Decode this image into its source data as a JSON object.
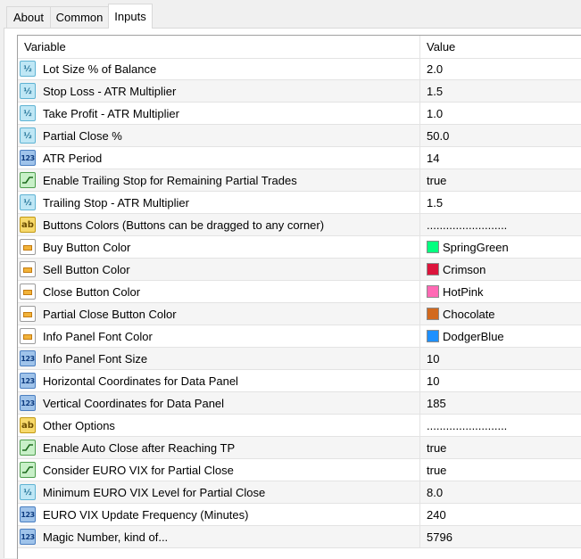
{
  "tabs": [
    {
      "label": "About"
    },
    {
      "label": "Common"
    },
    {
      "label": "Inputs"
    }
  ],
  "grid": {
    "headers": {
      "variable": "Variable",
      "value": "Value"
    },
    "rows": [
      {
        "icon": "fraction-icon",
        "name": "Lot Size % of Balance",
        "value": "2.0"
      },
      {
        "icon": "fraction-icon",
        "name": "Stop Loss - ATR Multiplier",
        "value": "1.5"
      },
      {
        "icon": "fraction-icon",
        "name": "Take Profit - ATR Multiplier",
        "value": "1.0"
      },
      {
        "icon": "fraction-icon",
        "name": "Partial Close %",
        "value": "50.0"
      },
      {
        "icon": "integer-icon",
        "name": "ATR Period",
        "value": "14"
      },
      {
        "icon": "boolean-icon",
        "name": "Enable Trailing Stop for Remaining Partial Trades",
        "value": "true"
      },
      {
        "icon": "fraction-icon",
        "name": "Trailing Stop - ATR Multiplier",
        "value": "1.5"
      },
      {
        "icon": "string-icon",
        "name": "Buttons Colors (Buttons can be dragged to any corner)",
        "value": "........................."
      },
      {
        "icon": "color-icon",
        "name": "Buy Button Color",
        "value": "SpringGreen",
        "swatch": "#00ff7f"
      },
      {
        "icon": "color-icon",
        "name": "Sell Button Color",
        "value": "Crimson",
        "swatch": "#dc143c"
      },
      {
        "icon": "color-icon",
        "name": "Close Button Color",
        "value": "HotPink",
        "swatch": "#ff69b4"
      },
      {
        "icon": "color-icon",
        "name": "Partial Close Button Color",
        "value": "Chocolate",
        "swatch": "#d2691e"
      },
      {
        "icon": "color-icon",
        "name": "Info Panel Font Color",
        "value": "DodgerBlue",
        "swatch": "#1e90ff"
      },
      {
        "icon": "integer-icon",
        "name": "Info Panel Font Size",
        "value": "10"
      },
      {
        "icon": "integer-icon",
        "name": "Horizontal Coordinates for Data Panel",
        "value": "10"
      },
      {
        "icon": "integer-icon",
        "name": "Vertical Coordinates for Data Panel",
        "value": "185"
      },
      {
        "icon": "string-icon",
        "name": "Other Options",
        "value": "........................."
      },
      {
        "icon": "boolean-icon",
        "name": "Enable Auto Close after Reaching TP",
        "value": "true"
      },
      {
        "icon": "boolean-icon",
        "name": "Consider EURO VIX for Partial Close",
        "value": "true"
      },
      {
        "icon": "fraction-icon",
        "name": "Minimum EURO VIX Level for Partial Close",
        "value": "8.0"
      },
      {
        "icon": "integer-icon",
        "name": "EURO VIX Update Frequency (Minutes)",
        "value": "240"
      },
      {
        "icon": "integer-icon",
        "name": "Magic Number, kind of...",
        "value": "5796"
      }
    ]
  }
}
